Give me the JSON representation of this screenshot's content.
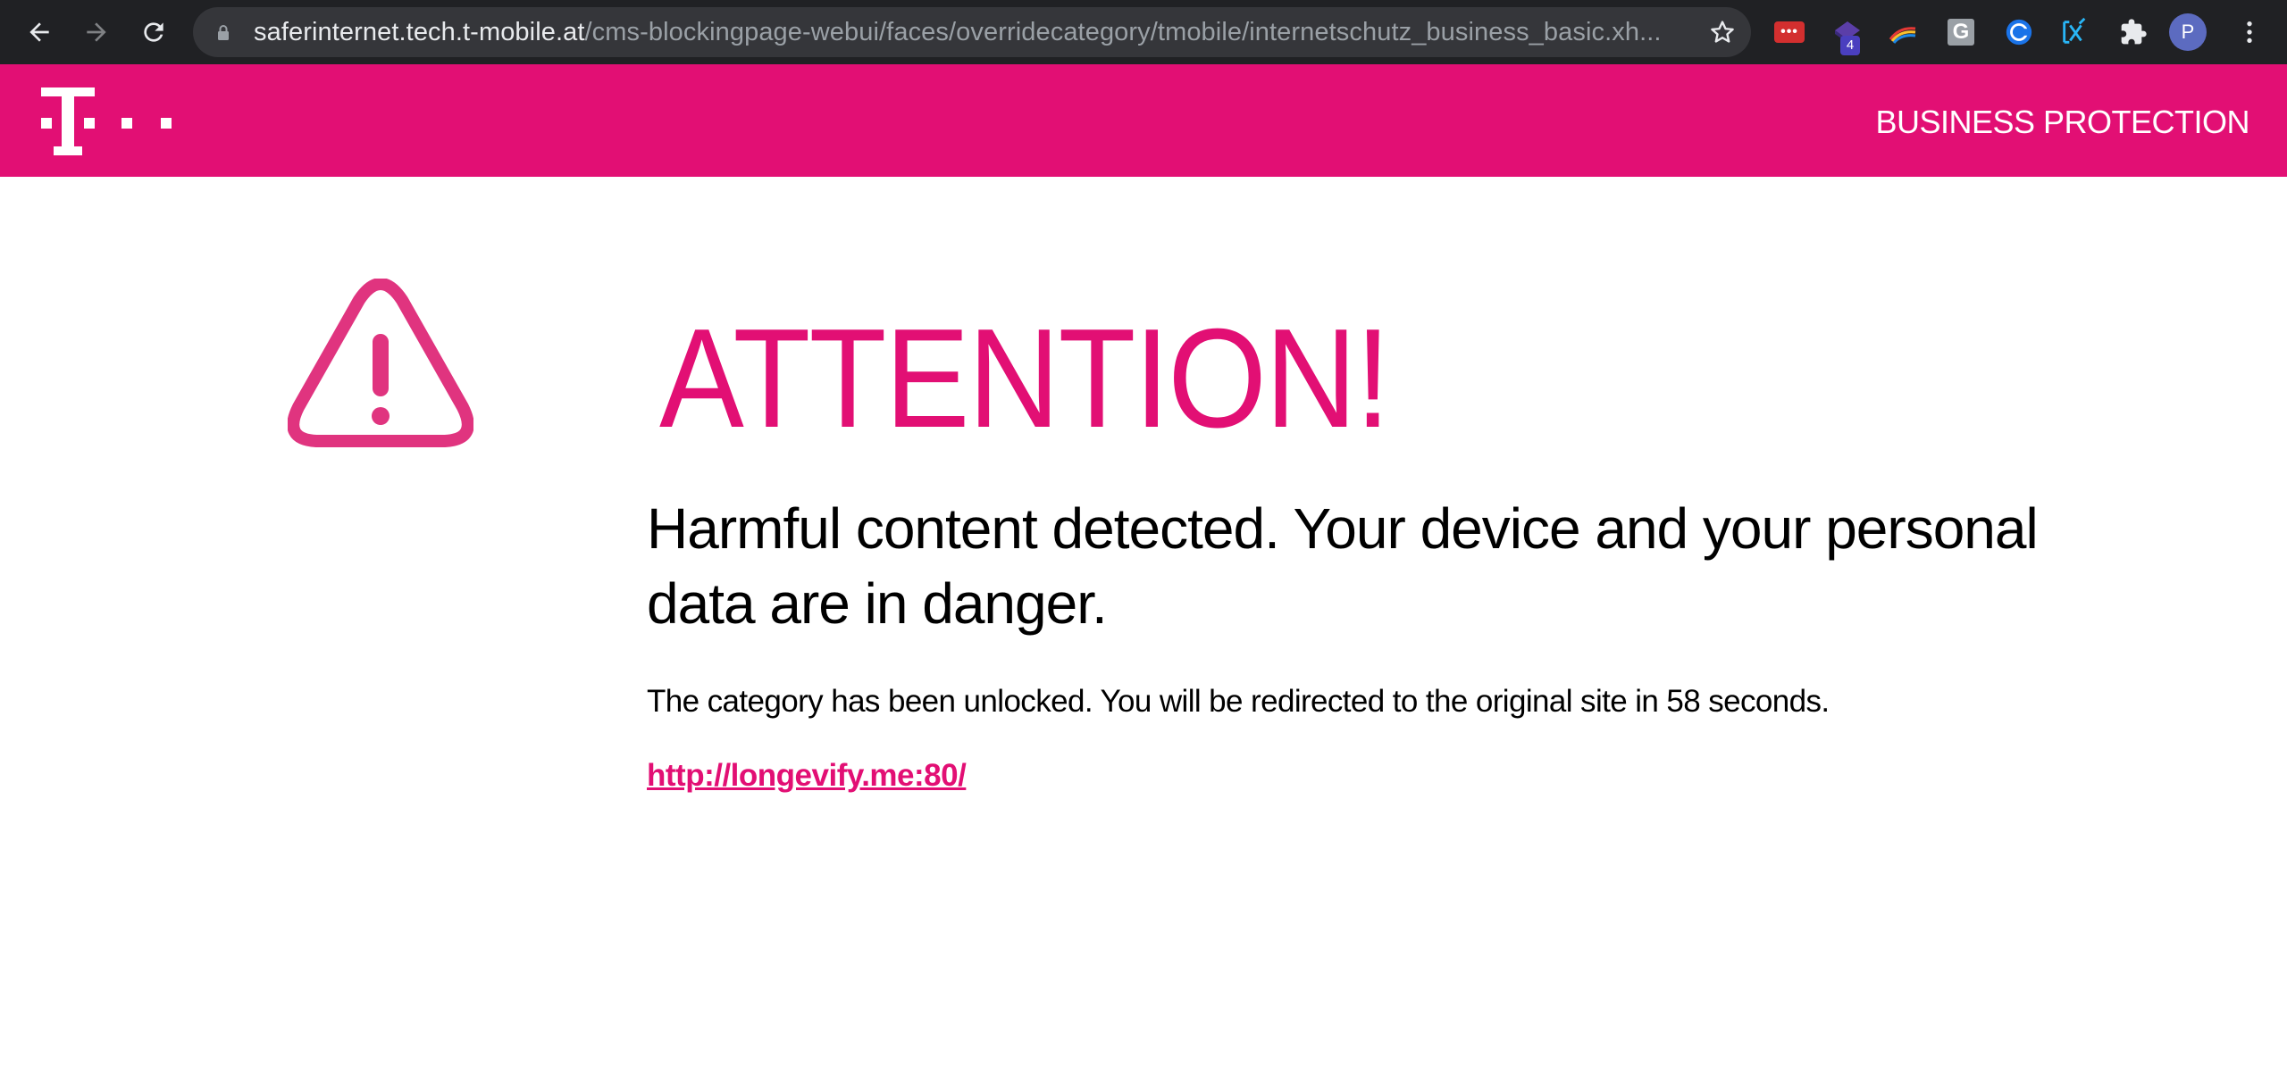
{
  "browser": {
    "url_host": "saferinternet.tech.t-mobile.at",
    "url_path": "/cms-blockingpage-webui/faces/overridecategory/tmobile/internetschutz_business_basic.xh...",
    "extensions": [
      {
        "name": "lastpass",
        "label": "•••"
      },
      {
        "name": "stack-extension",
        "badge": "4"
      },
      {
        "name": "rainbow-extension"
      },
      {
        "name": "grammarly-g",
        "label": "G"
      },
      {
        "name": "coupon-extension"
      },
      {
        "name": "xpath-extension"
      },
      {
        "name": "extensions-puzzle"
      }
    ],
    "profile_initial": "P",
    "colors": {
      "toolbar": "#202124",
      "omnibox": "#35363a"
    }
  },
  "header": {
    "section_label": "BUSINESS PROTECTION",
    "brand_color": "#e20f74"
  },
  "main": {
    "title": "ATTENTION!",
    "headline": "Harmful content detected. Your device and your personal data are in danger.",
    "message": "The category has been unlocked. You will be redirected to the original site in 58 seconds.",
    "link": "http://longevify.me:80/",
    "icon": "warning-triangle-icon"
  }
}
